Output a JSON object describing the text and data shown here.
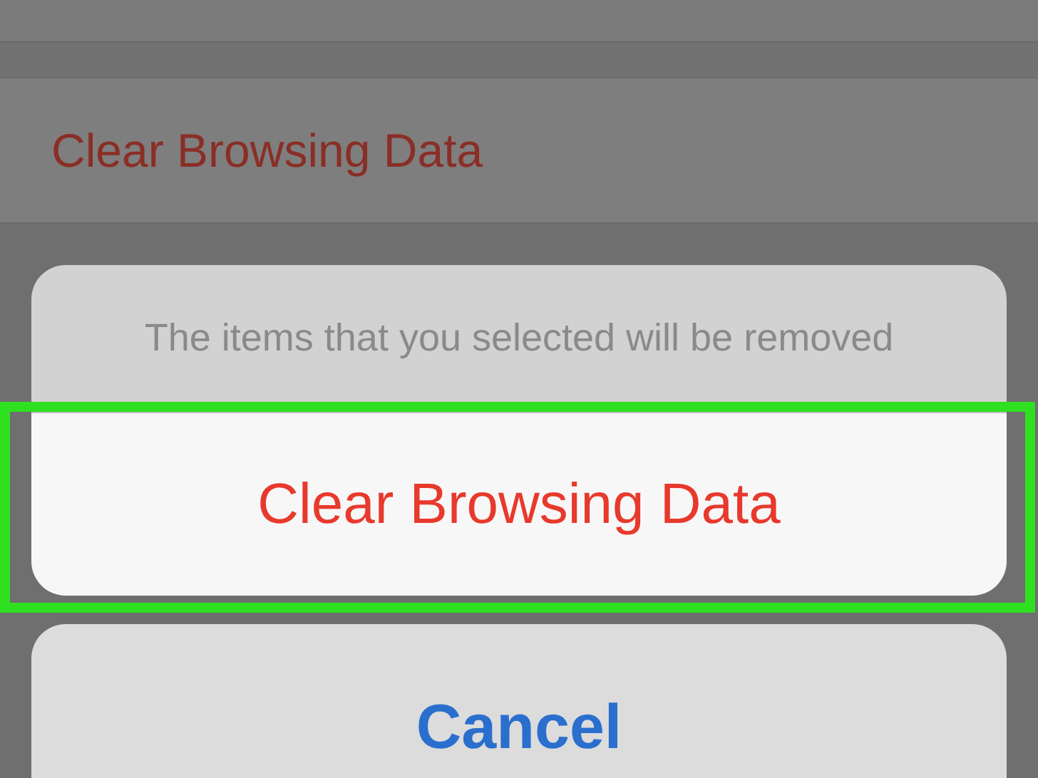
{
  "background_row": {
    "label": "Clear Browsing Data"
  },
  "action_sheet": {
    "message": "The items that you selected will be removed",
    "actions": [
      {
        "kind": "destructive",
        "label": "Clear Browsing Data",
        "highlighted": true
      }
    ],
    "cancel": {
      "label": "Cancel"
    }
  }
}
